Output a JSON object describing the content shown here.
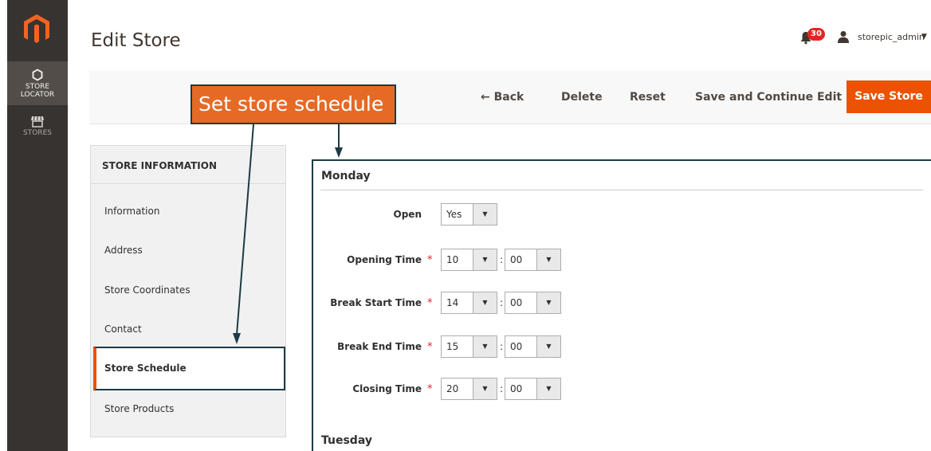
{
  "sidebar": {
    "logo": "magento-logo",
    "items": [
      {
        "label_line1": "STORE",
        "label_line2": "LOCATOR",
        "icon": "hexagon-icon",
        "active": true
      },
      {
        "label_line1": "STORES",
        "label_line2": "",
        "icon": "storefront-icon",
        "active": false
      }
    ]
  },
  "header": {
    "title": "Edit Store",
    "notifications_count": "30",
    "user_name": "storepic_admin"
  },
  "actions": {
    "back": "← Back",
    "delete": "Delete",
    "reset": "Reset",
    "save_continue": "Save and Continue Edit",
    "save": "Save Store"
  },
  "annotation": {
    "callout": "Set store schedule"
  },
  "tabs": {
    "title": "STORE INFORMATION",
    "items": [
      "Information",
      "Address",
      "Store Coordinates",
      "Contact",
      "Store Schedule",
      "Store Products"
    ],
    "active": "Store Schedule"
  },
  "schedule": {
    "day1": "Monday",
    "day2": "Tuesday",
    "open_label": "Open",
    "open_value": "Yes",
    "rows": [
      {
        "label": "Opening Time",
        "hour": "10",
        "minute": "00"
      },
      {
        "label": "Break Start Time",
        "hour": "14",
        "minute": "00"
      },
      {
        "label": "Break End Time",
        "hour": "15",
        "minute": "00"
      },
      {
        "label": "Closing Time",
        "hour": "20",
        "minute": "00"
      }
    ],
    "required_mark": "*",
    "separator": ":"
  },
  "colors": {
    "accent": "#eb5202",
    "sidebar": "#373330",
    "callout": "#e56a26",
    "outline": "#1d3a47",
    "badge": "#e22626"
  }
}
